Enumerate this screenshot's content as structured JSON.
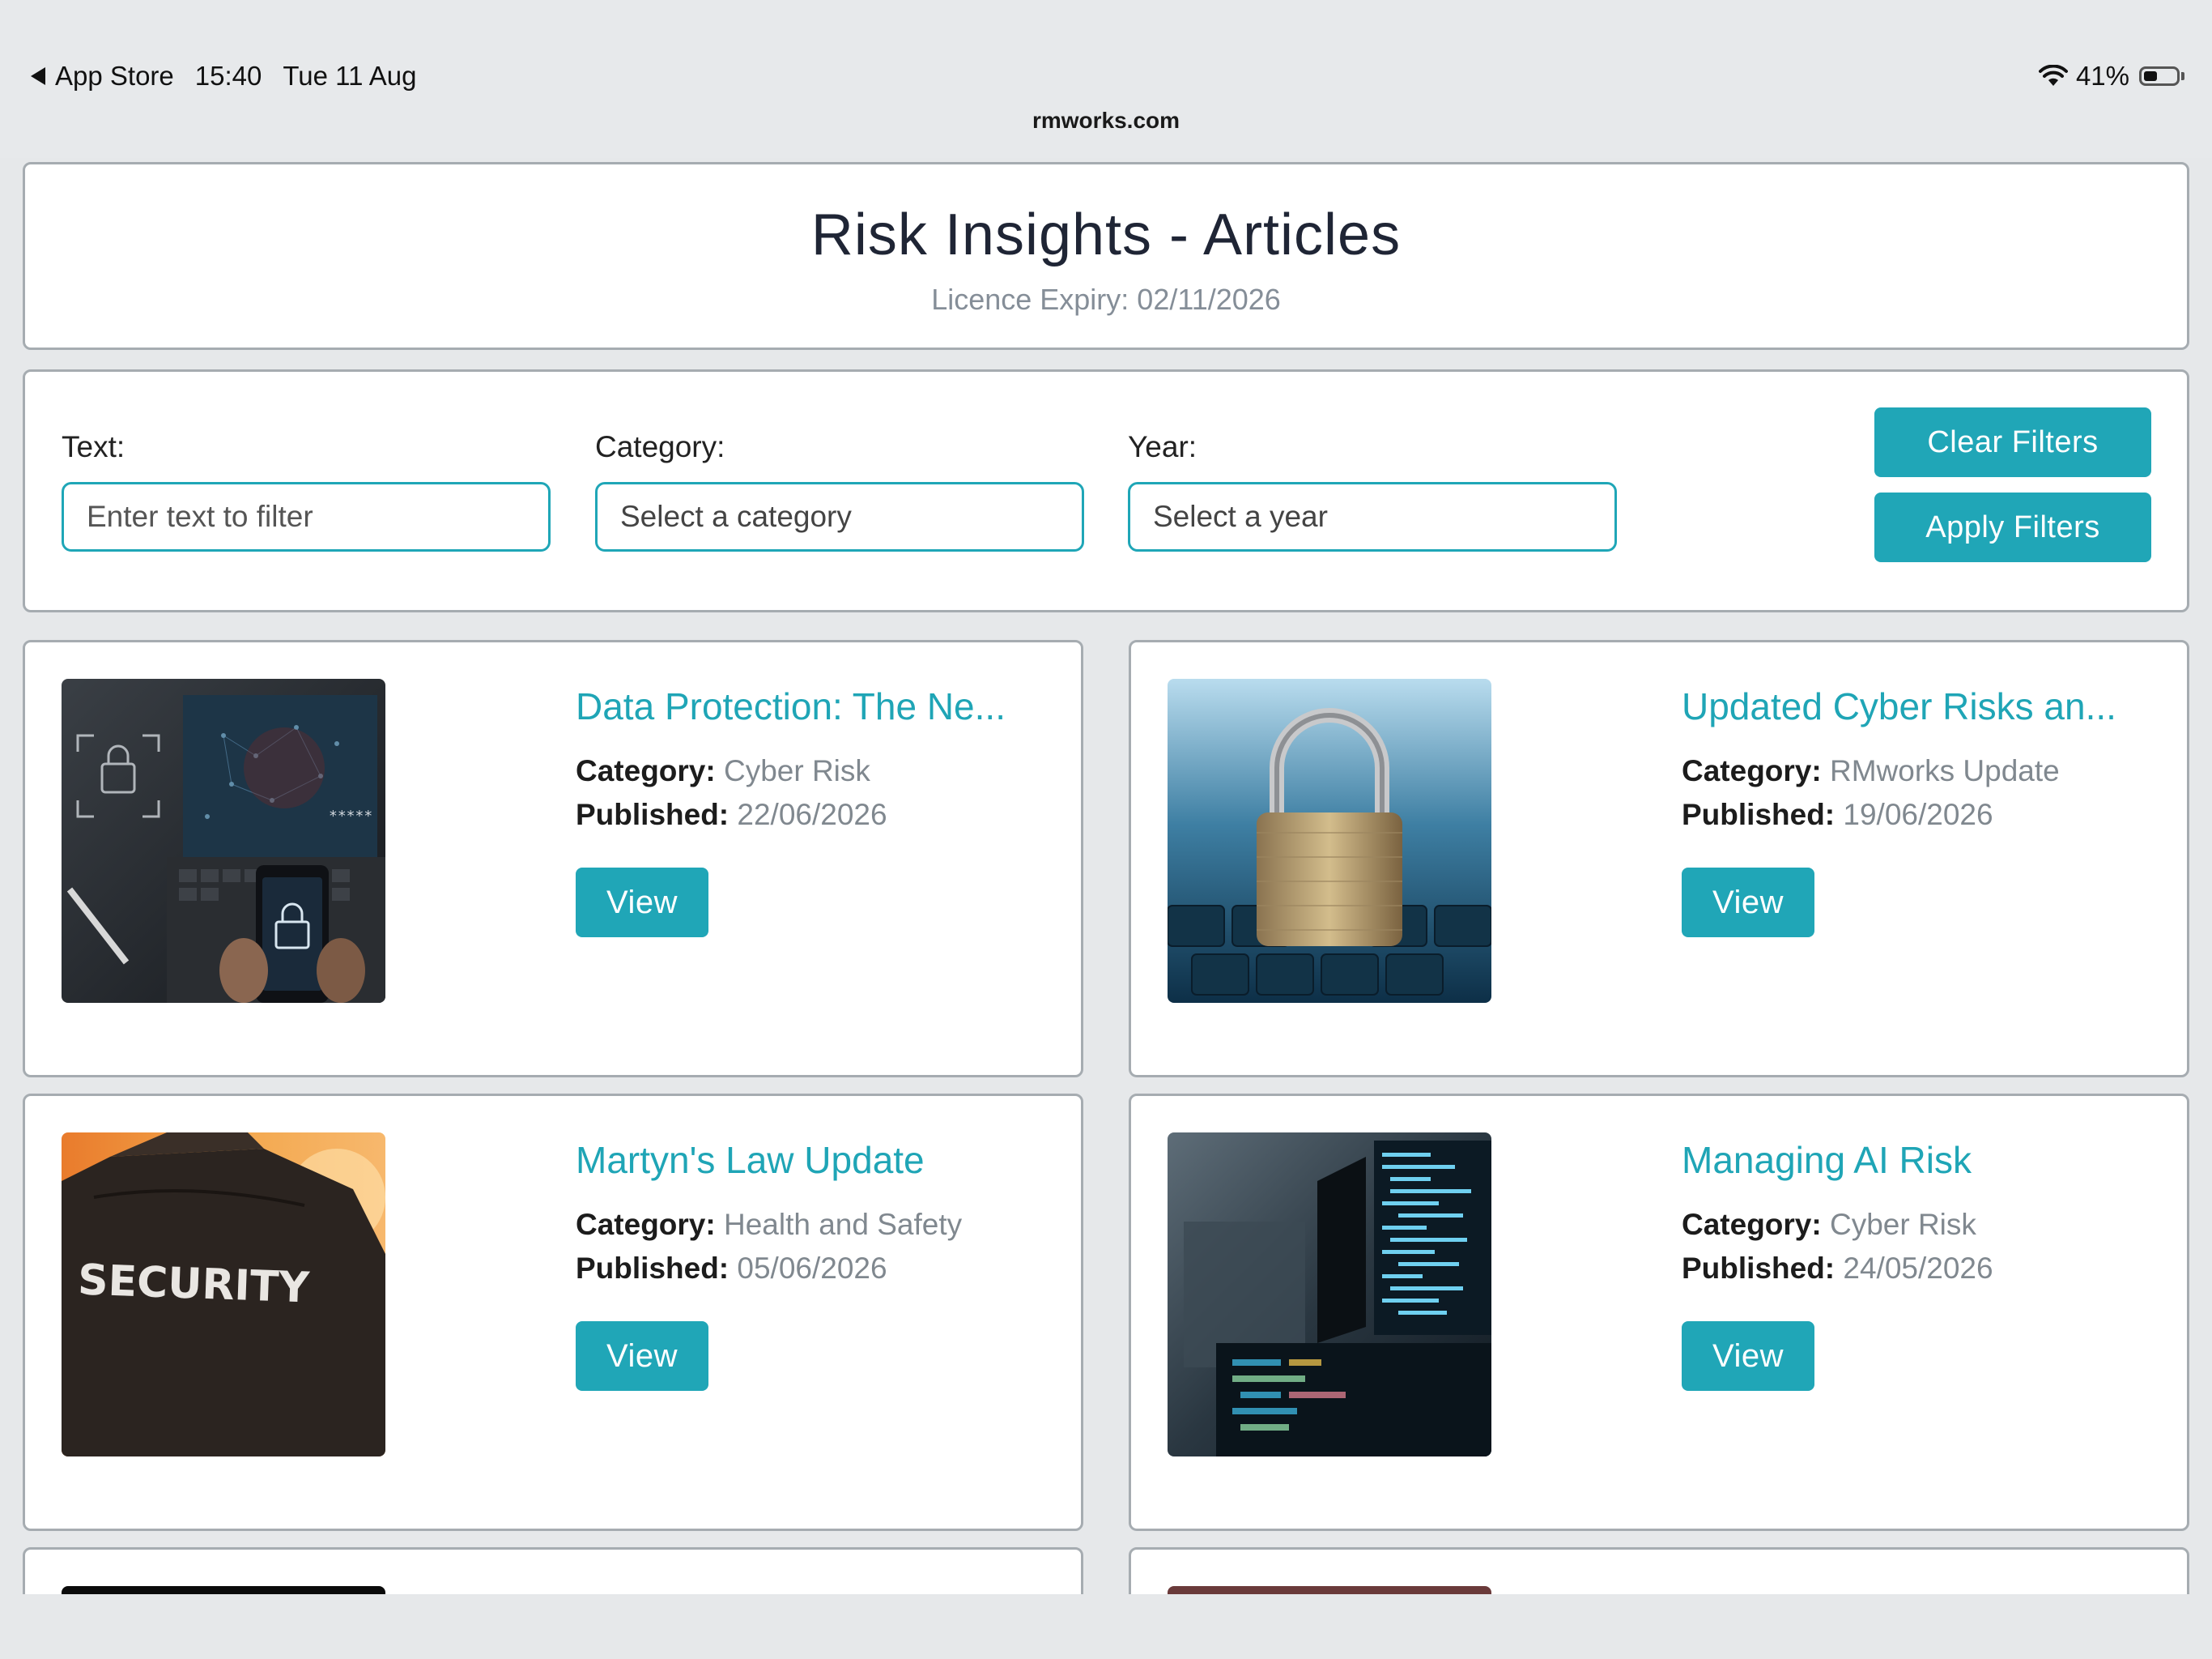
{
  "status_bar": {
    "back_label": "App Store",
    "time": "15:40",
    "date": "Tue 11 Aug",
    "battery": "41%",
    "battery_level": 0.41,
    "url": "rmworks.com"
  },
  "header": {
    "title": "Risk Insights - Articles",
    "licence_expiry": "Licence Expiry: 02/11/2026"
  },
  "filters": {
    "text_label": "Text:",
    "text_placeholder": "Enter text to filter",
    "category_label": "Category:",
    "category_placeholder": "Select a category",
    "year_label": "Year:",
    "year_placeholder": "Select a year",
    "clear_label": "Clear Filters",
    "apply_label": "Apply Filters"
  },
  "labels": {
    "category": "Category:",
    "published": "Published:",
    "view": "View"
  },
  "articles": [
    {
      "title": "Data Protection: The Ne...",
      "category": "Cyber Risk",
      "published": "22/06/2026",
      "image": "laptop-padlock-image"
    },
    {
      "title": "Updated Cyber Risks an...",
      "category": "RMworks Update",
      "published": "19/06/2026",
      "image": "padlock-keyboard-image"
    },
    {
      "title": "Martyn's Law Update",
      "category": "Health and Safety",
      "published": "05/06/2026",
      "image": "security-guard-image",
      "image_text": "SECURITY"
    },
    {
      "title": "Managing AI Risk",
      "category": "Cyber Risk",
      "published": "24/05/2026",
      "image": "code-monitors-image"
    }
  ],
  "colors": {
    "accent": "#20a6b7",
    "border": "#a6acb1",
    "background": "#e6e8ea"
  }
}
